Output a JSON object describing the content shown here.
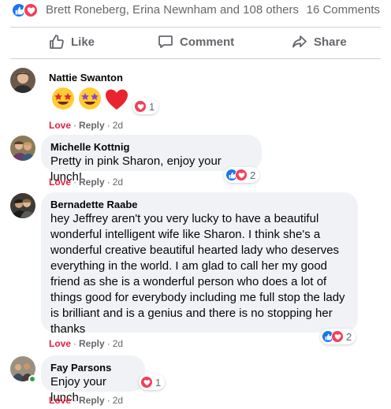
{
  "summary": {
    "names": "Brett Roneberg, Erina Newnham and 108 others",
    "comments": "16 Comments"
  },
  "actions": {
    "like": "Like",
    "comment": "Comment",
    "share": "Share"
  },
  "comments": [
    {
      "author": "Nattie Swanton",
      "text": "",
      "emojis": [
        "star-struck-emoji",
        "star-struck-emoji",
        "red-heart-emoji"
      ],
      "like": "Love",
      "reply": "Reply",
      "time": "2d",
      "reaction_count": "1",
      "reactions": [
        "love"
      ]
    },
    {
      "author": "Michelle Kottnig",
      "text": "Pretty in pink Sharon, enjoy your lunch!",
      "like": "Love",
      "reply": "Reply",
      "time": "2d",
      "reaction_count": "2",
      "reactions": [
        "like",
        "love"
      ]
    },
    {
      "author": "Bernadette Raabe",
      "text": "hey Jeffrey aren't you very lucky to have a beautiful wonderful intelligent wife like Sharon. I think she's a wonderful creative beautiful hearted lady who deserves everything in the world. I am glad to call her my good friend as she is a wonderful person who does a lot of things good for everybody including me full stop the lady is brilliant and is a genius and there is no stopping her thanks",
      "like": "Love",
      "reply": "Reply",
      "time": "2d",
      "reaction_count": "2",
      "reactions": [
        "like",
        "love"
      ]
    },
    {
      "author": "Fay Parsons",
      "text": "Enjoy your lunch",
      "like": "Love",
      "reply": "Reply",
      "time": "2d",
      "reaction_count": "1",
      "reactions": [
        "love"
      ]
    }
  ],
  "colors": {
    "accent": "#1877f2",
    "love": "#f33e58",
    "love_text": "#e41e3f",
    "bubble": "#f0f2f5",
    "muted": "#65676b"
  }
}
